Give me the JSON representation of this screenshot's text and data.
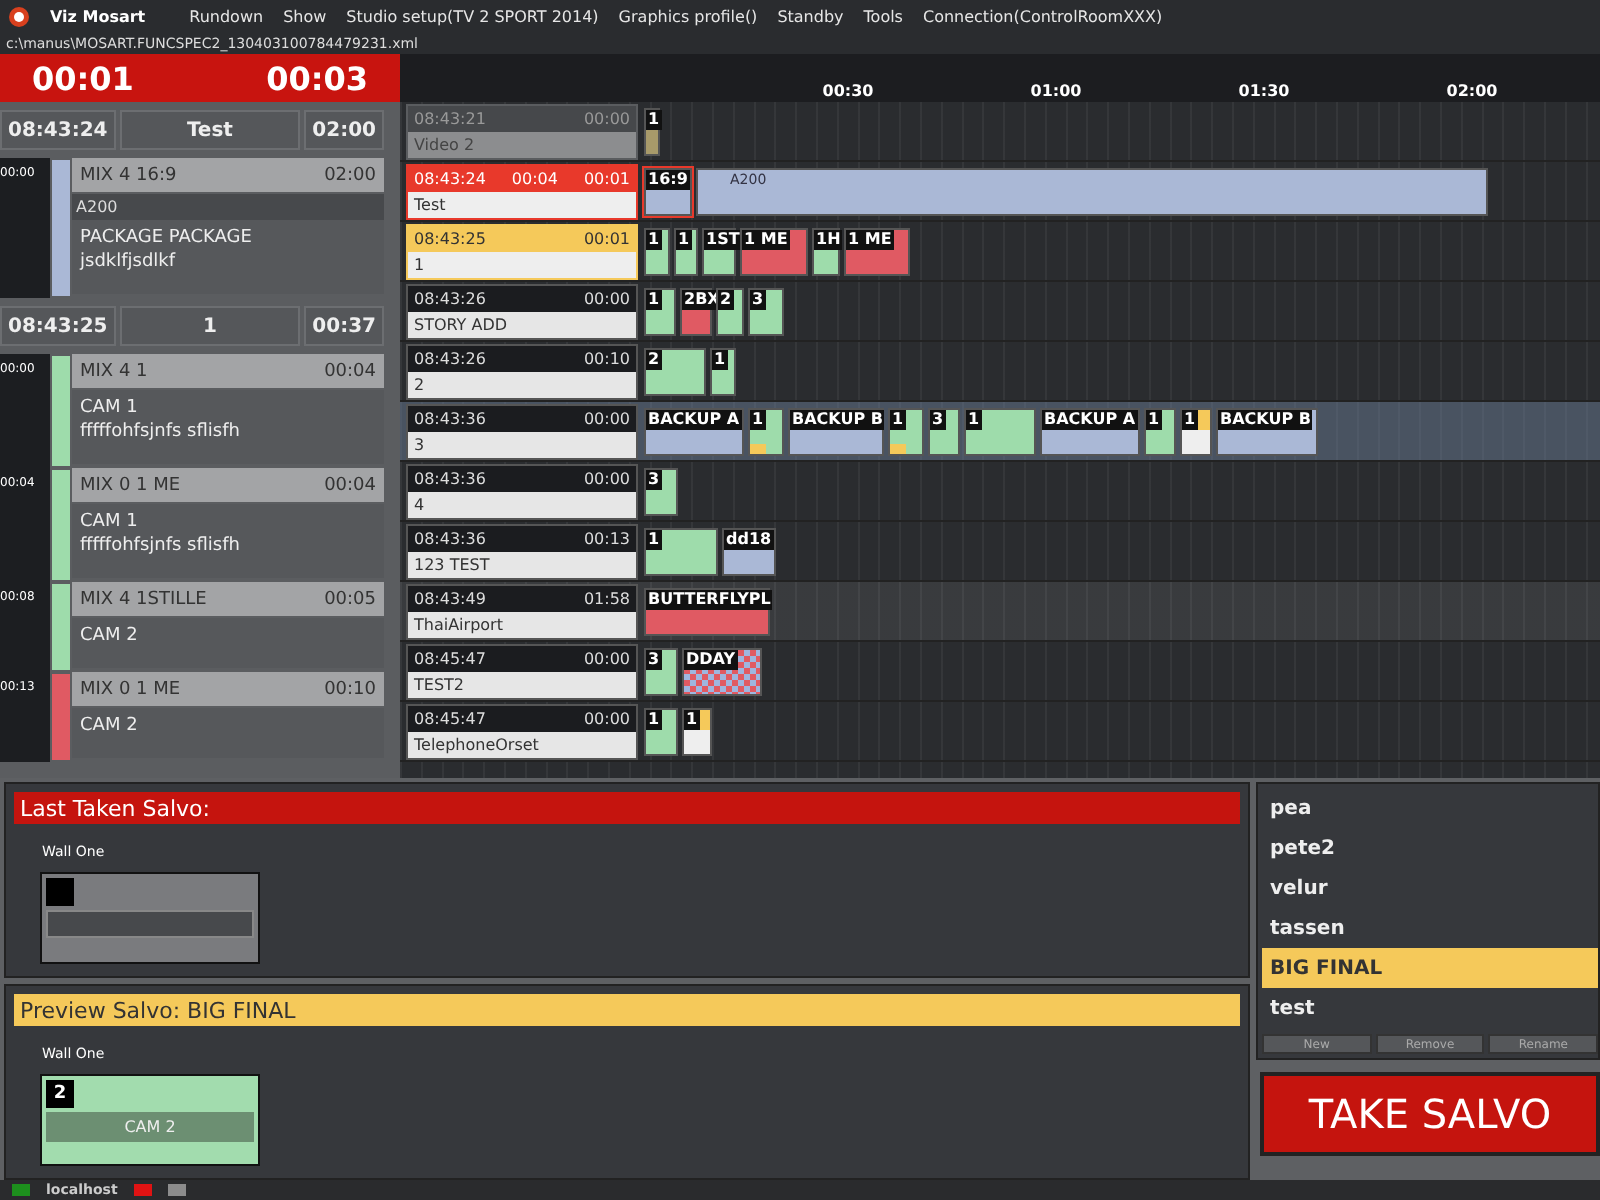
{
  "app": {
    "name": "Viz Mosart"
  },
  "menu": [
    "Rundown",
    "Show",
    "Studio setup(TV 2 SPORT 2014)",
    "Graphics profile()",
    "Standby",
    "Tools",
    "Connection(ControlRoomXXX)"
  ],
  "file_path": "c:\\manus\\MOSART.FUNCSPEC2_130403100784479231.xml",
  "timers": {
    "elapsed": "00:01",
    "remaining": "00:03"
  },
  "rundown": {
    "groups": [
      {
        "time": "08:43:24",
        "title": "Test",
        "duration": "02:00",
        "items": [
          {
            "offset": "00:00",
            "type": "MIX 4 16:9",
            "duration": "02:00",
            "color": "#aab8d6",
            "strip": "A200",
            "lines": [
              "PACKAGE PACKAGE",
              "jsdklfjsdlkf"
            ]
          }
        ]
      },
      {
        "time": "08:43:25",
        "title": "1",
        "duration": "00:37",
        "items": [
          {
            "offset": "00:00",
            "type": "MIX 4 1",
            "duration": "00:04",
            "color": "#9edcab",
            "lines": [
              "CAM 1",
              "fffffohfsjnfs sflisfh"
            ]
          },
          {
            "offset": "00:04",
            "type": "MIX 0 1 ME",
            "duration": "00:04",
            "color": "#9edcab",
            "lines": [
              "CAM 1",
              "fffffohfsjnfs sflisfh"
            ]
          },
          {
            "offset": "00:08",
            "type": "MIX 4 1STILLE",
            "duration": "00:05",
            "color": "#9edcab",
            "lines": [
              "CAM 2"
            ]
          },
          {
            "offset": "00:13",
            "type": "MIX 0 1 ME",
            "duration": "00:10",
            "color": "#e05a63",
            "lines": [
              "CAM 2"
            ]
          }
        ]
      }
    ]
  },
  "timeline": {
    "ticks": [
      "00:30",
      "01:00",
      "01:30",
      "02:00"
    ],
    "stories": [
      {
        "time": "08:43:21",
        "duration": "00:00",
        "title": "Video 2",
        "kind": "played",
        "selected": false,
        "highlighted": false,
        "clips": [
          {
            "label": "1",
            "kind": "tan"
          }
        ]
      },
      {
        "time": "08:43:24",
        "elapsed": "00:04",
        "duration": "00:01",
        "title": "Test",
        "kind": "on_air",
        "selected": false,
        "highlighted": false,
        "clips": [
          {
            "label": "16:9",
            "kind": "current"
          },
          {
            "label": "A200",
            "kind": "blue_text"
          }
        ]
      },
      {
        "time": "08:43:25",
        "duration": "00:01",
        "title": "1",
        "kind": "next",
        "selected": false,
        "highlighted": false,
        "clips": [
          {
            "label": "1",
            "kind": "green"
          },
          {
            "label": "1",
            "kind": "green"
          },
          {
            "label": "1ST",
            "kind": "green"
          },
          {
            "label": "1 ME",
            "kind": "red"
          },
          {
            "label": "1H",
            "kind": "green"
          },
          {
            "label": "1 ME",
            "kind": "red"
          }
        ]
      },
      {
        "time": "08:43:26",
        "duration": "00:00",
        "title": "STORY ADD",
        "kind": "ready",
        "selected": false,
        "highlighted": false,
        "clips": [
          {
            "label": "1",
            "kind": "green"
          },
          {
            "label": "2BX",
            "kind": "red_yellow"
          },
          {
            "label": "2",
            "kind": "green"
          },
          {
            "label": "3",
            "kind": "green"
          }
        ]
      },
      {
        "time": "08:43:26",
        "duration": "00:10",
        "title": "2",
        "kind": "ready",
        "selected": false,
        "highlighted": false,
        "clips": [
          {
            "label": "2",
            "kind": "green"
          },
          {
            "label": "1",
            "kind": "green"
          }
        ]
      },
      {
        "time": "08:43:36",
        "duration": "00:00",
        "title": "3",
        "kind": "ready",
        "selected": true,
        "highlighted": false,
        "clips": [
          {
            "label": "BACKUP A",
            "kind": "blue"
          },
          {
            "label": "1",
            "kind": "green_yellow"
          },
          {
            "label": "BACKUP B",
            "kind": "blue"
          },
          {
            "label": "1",
            "kind": "green_yellow"
          },
          {
            "label": "3",
            "kind": "green"
          },
          {
            "label": "1",
            "kind": "green"
          },
          {
            "label": "BACKUP A",
            "kind": "blue"
          },
          {
            "label": "1",
            "kind": "green"
          },
          {
            "label": "1",
            "kind": "yellow"
          },
          {
            "label": "BACKUP B",
            "kind": "blue"
          }
        ]
      },
      {
        "time": "08:43:36",
        "duration": "00:00",
        "title": "4",
        "kind": "ready",
        "selected": false,
        "highlighted": false,
        "clips": [
          {
            "label": "3",
            "kind": "green"
          }
        ]
      },
      {
        "time": "08:43:36",
        "duration": "00:13",
        "title": "123 TEST",
        "kind": "ready",
        "selected": false,
        "highlighted": false,
        "clips": [
          {
            "label": "1",
            "kind": "green"
          },
          {
            "label": "dd18",
            "kind": "blue_arrow"
          }
        ]
      },
      {
        "time": "08:43:49",
        "duration": "01:58",
        "title": "ThaiAirport",
        "kind": "ready",
        "selected": false,
        "highlighted": true,
        "clips": [
          {
            "label": "BUTTERFLYPL",
            "kind": "red_yellow"
          }
        ]
      },
      {
        "time": "08:45:47",
        "duration": "00:00",
        "title": "TEST2",
        "kind": "ready",
        "selected": false,
        "highlighted": false,
        "clips": [
          {
            "label": "3",
            "kind": "green"
          },
          {
            "label": "DDAY",
            "kind": "checker"
          }
        ]
      },
      {
        "time": "08:45:47",
        "duration": "00:00",
        "title": "TelephoneOrset",
        "kind": "ready",
        "selected": false,
        "highlighted": false,
        "clips": [
          {
            "label": "1",
            "kind": "green"
          },
          {
            "label": "1",
            "kind": "yellow"
          }
        ]
      }
    ]
  },
  "last_salvo": {
    "title": "Last Taken Salvo:",
    "kind": "taken",
    "wall": "Wall One",
    "tile": {
      "kind": "blank"
    }
  },
  "preview_salvo": {
    "title": "Preview Salvo: BIG FINAL",
    "kind": "preview",
    "wall": "Wall One",
    "tile": {
      "kind": "source",
      "number": "2",
      "label": "CAM 2"
    }
  },
  "salvo_list": {
    "items": [
      {
        "label": "pea",
        "selected": false
      },
      {
        "label": "pete2",
        "selected": false
      },
      {
        "label": "velur",
        "selected": false
      },
      {
        "label": "tassen",
        "selected": false
      },
      {
        "label": "BIG FINAL",
        "selected": true
      },
      {
        "label": "test",
        "selected": false
      }
    ],
    "buttons": [
      "New",
      "Remove",
      "Rename"
    ]
  },
  "take_button": "TAKE SALVO",
  "status_bar": {
    "indicators": [
      {
        "color": "#1d8f1d",
        "label": "localhost"
      },
      {
        "color": "#e01313"
      },
      {
        "color": "#8c8c8c"
      }
    ]
  }
}
